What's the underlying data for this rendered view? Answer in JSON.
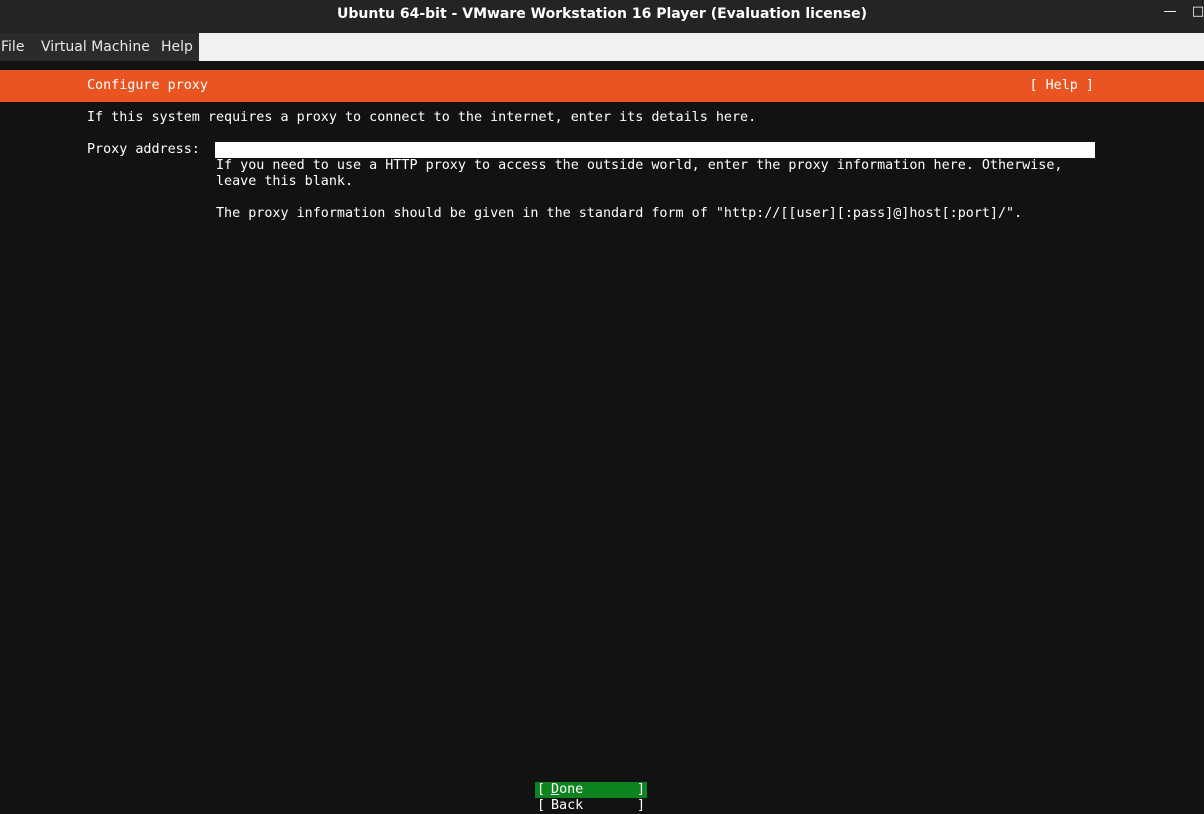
{
  "window": {
    "title": "Ubuntu 64-bit - VMware Workstation 16 Player (Evaluation license)",
    "minimize_glyph": "—",
    "maximize_glyph": "□"
  },
  "menu": {
    "items": [
      "File",
      "Virtual Machine",
      "Help"
    ]
  },
  "installer": {
    "header_title": "Configure proxy",
    "help_label": "[ Help ]",
    "intro": "If this system requires a proxy to connect to the internet, enter its details here.",
    "proxy_label": "Proxy address:",
    "proxy_value": "",
    "help_line1": "If you need to use a HTTP proxy to access the outside world, enter the proxy information here. Otherwise,",
    "help_line2": "leave this blank.",
    "help_form": "The proxy information should be given in the standard form of \"http://[[user][:pass]@]host[:port]/\".",
    "bracket_open": "[",
    "bracket_close": "]",
    "done_accel": "D",
    "done_rest": "one",
    "back_label": "Back"
  },
  "colors": {
    "header_bg": "#e95420",
    "done_bg": "#0e8420",
    "console_bg": "#121212"
  }
}
